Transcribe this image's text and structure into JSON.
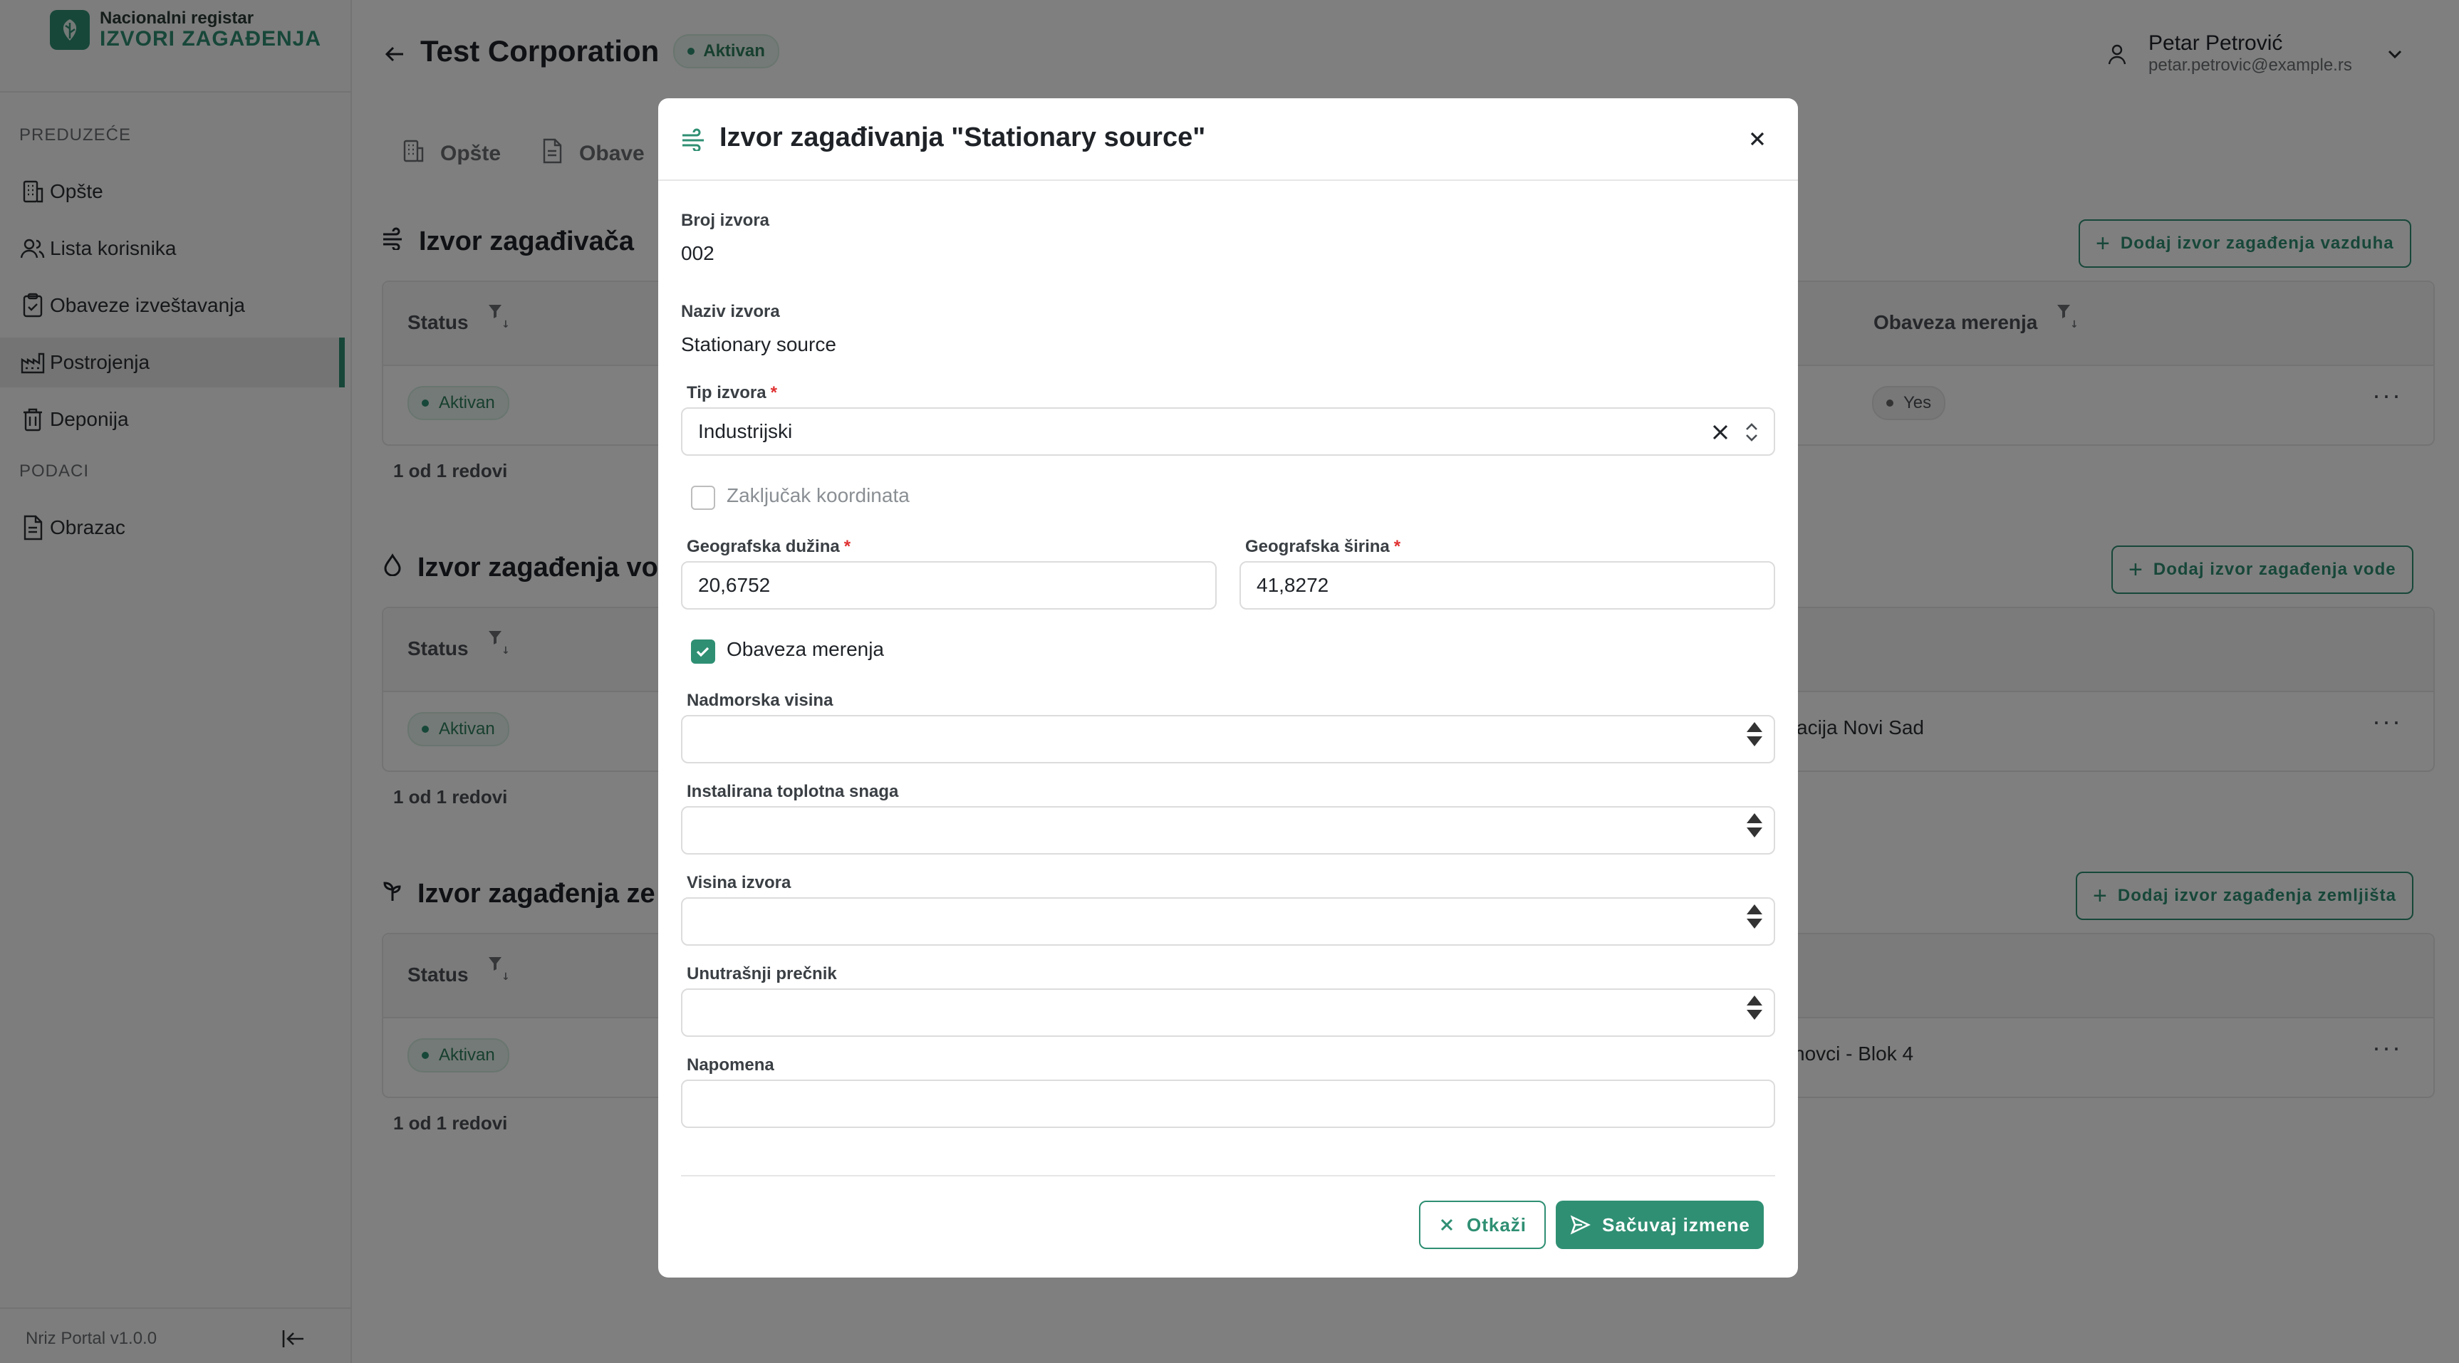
{
  "brand": {
    "line1": "Nacionalni registar",
    "line2": "IZVORI ZAGAĐENJA"
  },
  "sidebar": {
    "section1": "PREDUZEĆE",
    "items": [
      {
        "label": "Opšte",
        "icon": "building-icon"
      },
      {
        "label": "Lista korisnika",
        "icon": "users-icon"
      },
      {
        "label": "Obaveze izveštavanja",
        "icon": "clipboard-icon"
      },
      {
        "label": "Postrojenja",
        "icon": "factory-icon",
        "active": true
      },
      {
        "label": "Deponija",
        "icon": "trash-icon"
      }
    ],
    "section2": "PODACI",
    "items2": [
      {
        "label": "Obrazac",
        "icon": "document-icon"
      }
    ],
    "version": "Nriz Portal v1.0.0"
  },
  "header": {
    "title": "Test Corporation",
    "status": "Aktivan",
    "user_name": "Petar Petrović",
    "user_email": "petar.petrovic@example.rs"
  },
  "tabs": [
    {
      "label": "Opšte"
    },
    {
      "label": "Obave"
    }
  ],
  "sections": [
    {
      "title": "Izvor zagađivača",
      "add_label": "Dodaj izvor zagađenja vazduha",
      "col_status": "Status",
      "col_right": "Obaveza merenja",
      "row_status": "Aktivan",
      "row_right": "Yes",
      "rows_count": "1 od 1 redovi"
    },
    {
      "title": "Izvor zagađenja vo",
      "add_label": "Dodaj izvor zagađenja vode",
      "col_status": "Status",
      "row_status": "Aktivan",
      "row_right": "acija Novi Sad",
      "rows_count": "1 od 1 redovi"
    },
    {
      "title": "Izvor zagađenja ze",
      "add_label": "Dodaj izvor zagađenja zemljišta",
      "col_status": "Status",
      "row_status": "Aktivan",
      "row_right": "novci - Blok 4",
      "rows_count": "1 od 1 redovi"
    }
  ],
  "modal": {
    "title": "Izvor zagađivanja \"Stationary source\"",
    "broj_label": "Broj izvora",
    "broj_value": "002",
    "naziv_label": "Naziv izvora",
    "naziv_value": "Stationary source",
    "tip_label": "Tip izvora",
    "tip_value": "Industrijski",
    "zakljucak_label": "Zaključak koordinata",
    "zakljucak_checked": false,
    "duzina_label": "Geografska dužina",
    "duzina_value": "20,6752",
    "sirina_label": "Geografska širina",
    "sirina_value": "41,8272",
    "obaveza_label": "Obaveza merenja",
    "obaveza_checked": true,
    "nadmorska_label": "Nadmorska visina",
    "toplotna_label": "Instalirana toplotna snaga",
    "visina_label": "Visina izvora",
    "precnik_label": "Unutrašnji prečnik",
    "napomena_label": "Napomena",
    "cancel_label": "Otkaži",
    "save_label": "Sačuvaj izmene",
    "required_mark": "*"
  },
  "colors": {
    "accent": "#2f8f73",
    "required": "#e03131"
  }
}
